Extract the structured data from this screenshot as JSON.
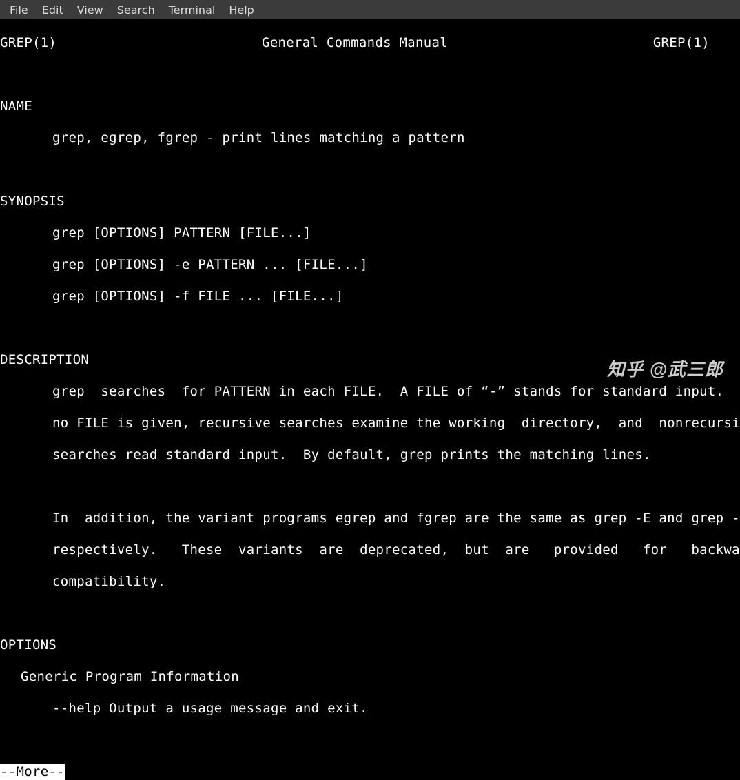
{
  "menubar": {
    "items": [
      "File",
      "Edit",
      "View",
      "Search",
      "Terminal",
      "Help"
    ]
  },
  "manpage": {
    "header_left": "GREP(1)",
    "header_center": "General Commands Manual",
    "header_right": "GREP(1)",
    "sections": {
      "name": {
        "title": "NAME",
        "line": "grep, egrep, fgrep - print lines matching a pattern"
      },
      "synopsis": {
        "title": "SYNOPSIS",
        "lines": [
          "grep [OPTIONS] PATTERN [FILE...]",
          "grep [OPTIONS] -e PATTERN ... [FILE...]",
          "grep [OPTIONS] -f FILE ... [FILE...]"
        ]
      },
      "description": {
        "title": "DESCRIPTION",
        "para1": [
          "grep  searches  for PATTERN in each FILE.  A FILE of “-” stands for standard input.  If",
          "no FILE is given, recursive searches examine the working  directory,  and  nonrecursive",
          "searches read standard input.  By default, grep prints the matching lines."
        ],
        "para2": [
          "In  addition, the variant programs egrep and fgrep are the same as grep -E and grep -F,",
          "respectively.   These  variants  are  deprecated,  but  are   provided   for   backward",
          "compatibility."
        ]
      },
      "options": {
        "title": "OPTIONS",
        "subheading": "Generic Program Information",
        "help_line": "--help Output a usage message and exit."
      }
    },
    "more_prompt": "--More--"
  },
  "watermark": {
    "brand": "知乎",
    "user": "@武三郎"
  }
}
